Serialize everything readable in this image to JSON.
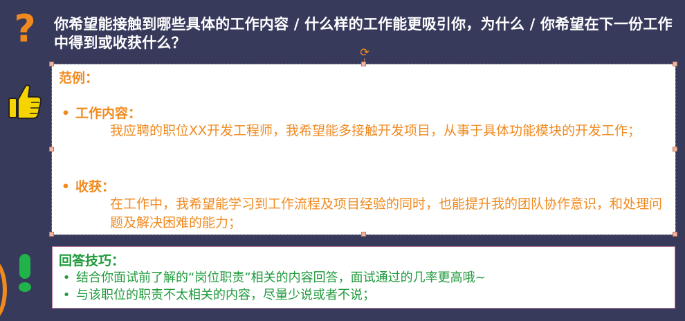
{
  "question": {
    "icon": "question-mark-icon",
    "text": "你希望能接触到哪些具体的工作内容 / 什么样的工作能更吸引你，为什么 / 你希望在下一份工作中得到或收获什么？"
  },
  "example": {
    "icon": "thumbs-up-icon",
    "title": "范例：",
    "items": [
      {
        "heading": "工作内容：",
        "detail": "我应聘的职位XX开发工程师，我希望能多接触开发项目，从事于具体功能模块的开发工作；"
      },
      {
        "heading": "收获：",
        "detail": "在工作中，我希望能学习到工作流程及项目经验的同时，也能提升我的团队协作意识，和处理问题及解决困难的能力；"
      }
    ]
  },
  "tips": {
    "icon": "exclamation-icon",
    "title": "回答技巧：",
    "items": [
      "结合你面试前了解的“岗位职责”相关的内容回答，面试通过的几率更高哦~",
      "与该职位的职责不太相关的内容，尽量少说或者不说；"
    ]
  },
  "colors": {
    "background": "#383a5c",
    "accent_orange": "#f08a1f",
    "tip_green": "#1f9a3c"
  }
}
